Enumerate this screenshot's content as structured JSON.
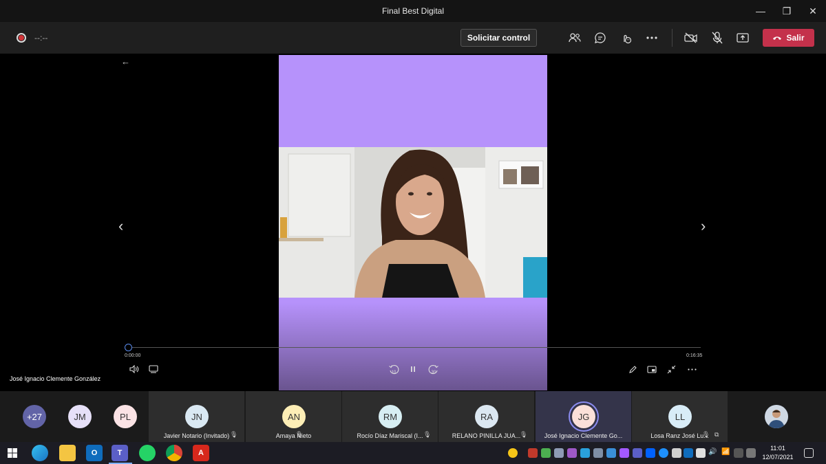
{
  "window": {
    "title": "Final Best Digital",
    "minimize": "—",
    "restore": "❐",
    "close": "✕"
  },
  "toolbar": {
    "timer": "--:--",
    "request_control_label": "Solicitar control",
    "leave_label": "Salir",
    "leave_color": "#c4314b"
  },
  "viewer": {
    "back_arrow": "←",
    "prev_arrow": "‹",
    "next_arrow": "›",
    "time_current": "0:00:00",
    "time_total": "0:16:35",
    "progress_fraction": 0,
    "rewind_label": "10",
    "forward_label": "30",
    "speaker_name": "José Ignacio Clemente González",
    "accent_color": "#b692fb"
  },
  "participants": {
    "overflow": {
      "label": "+27",
      "color": "#6264a7"
    },
    "small_avatars": [
      {
        "initials": "JM",
        "color": "#e6e0f8"
      },
      {
        "initials": "PL",
        "color": "#fbe3e5"
      }
    ],
    "tiles": [
      {
        "initials": "JN",
        "name": "Javier Notario (Invitado)",
        "color": "#d9e8f2"
      },
      {
        "initials": "AN",
        "name": "Amaya Nieto",
        "color": "#fdeeb6"
      },
      {
        "initials": "RM",
        "name": "Rocío Díaz Mariscal (I...",
        "color": "#d7eef3"
      },
      {
        "initials": "RA",
        "name": "RELANO PINILLA JUA...",
        "color": "#dbe7f1"
      },
      {
        "initials": "JG",
        "name": "José Ignacio Clemente Go...",
        "color": "#fbe0d9"
      },
      {
        "initials": "LL",
        "name": "Losa Ranz José Lu...",
        "color": "#d8ecf7"
      }
    ]
  },
  "taskbar": {
    "time": "11:01",
    "date": "12/07/2021",
    "apps": [
      "windows-icon",
      "edge-icon",
      "file-explorer-icon",
      "outlook-icon",
      "teams-icon",
      "whatsapp-icon",
      "chrome-icon",
      "acrobat-icon"
    ]
  }
}
